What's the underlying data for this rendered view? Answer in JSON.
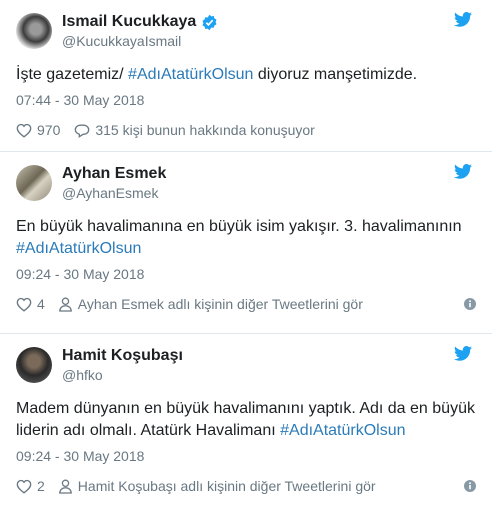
{
  "tweets": [
    {
      "name": "Ismail Kucukkaya",
      "handle": "@KucukkayaIsmail",
      "verified": true,
      "text_parts": [
        "İşte gazetemiz/ ",
        "#AdıAtatürkOlsun",
        " diyoruz manşetimizde."
      ],
      "timestamp": "07:44 - 30 May 2018",
      "likes": "970",
      "secondary": "315 kişi bunun hakkında konuşuyor"
    },
    {
      "name": "Ayhan Esmek",
      "handle": "@AyhanEsmek",
      "verified": false,
      "text_parts": [
        "En büyük havalimanına en büyük isim yakışır. 3. havalimanının ",
        "#AdıAtatürkOlsun"
      ],
      "timestamp": "09:24 - 30 May 2018",
      "likes": "4",
      "secondary": "Ayhan Esmek adlı kişinin diğer Tweetlerini gör"
    },
    {
      "name": "Hamit Koşubaşı",
      "handle": "@hfko",
      "verified": false,
      "text_parts": [
        "Madem dünyanın en büyük havalimanını yaptık. Adı da en büyük liderin adı olmalı. Atatürk Havalimanı ",
        "#AdıAtatürkOlsun"
      ],
      "timestamp": "09:24 - 30 May 2018",
      "likes": "2",
      "secondary": "Hamit Koşubaşı adlı kişinin diğer Tweetlerini gör"
    }
  ],
  "colors": {
    "link": "#2b7bb9",
    "muted": "#697882",
    "twitter_blue": "#1da1f2",
    "divider": "#e1e8ed"
  },
  "icons": [
    "verified-badge-icon",
    "twitter-bird-icon",
    "heart-icon",
    "reply-bubble-icon",
    "person-icon",
    "info-icon"
  ]
}
